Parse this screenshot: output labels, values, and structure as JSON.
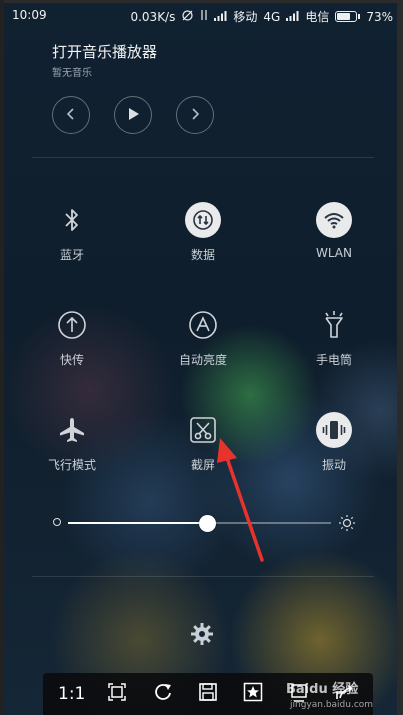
{
  "status_bar": {
    "time": "10:09",
    "speed": "0.03K/s",
    "carrier1": "移动",
    "network": "4G",
    "carrier2": "电信",
    "battery": "73%",
    "battery_level": 0.73
  },
  "music": {
    "title": "打开音乐播放器",
    "subtitle": "暂无音乐",
    "controls": [
      "previous-icon",
      "play-icon",
      "next-icon"
    ]
  },
  "toggles": [
    {
      "id": "bluetooth",
      "label": "蓝牙",
      "icon": "bluetooth-icon",
      "active": false
    },
    {
      "id": "data",
      "label": "数据",
      "icon": "mobile-data-icon",
      "active": true
    },
    {
      "id": "wlan",
      "label": "WLAN",
      "icon": "wifi-icon",
      "active": true
    },
    {
      "id": "quick-share",
      "label": "快传",
      "icon": "upload-icon",
      "active": false
    },
    {
      "id": "auto-brightness",
      "label": "自动亮度",
      "icon": "auto-brightness-icon",
      "active": false
    },
    {
      "id": "flashlight",
      "label": "手电筒",
      "icon": "flashlight-icon",
      "active": false
    },
    {
      "id": "airplane",
      "label": "飞行模式",
      "icon": "airplane-icon",
      "active": false
    },
    {
      "id": "screenshot",
      "label": "截屏",
      "icon": "screenshot-scissors-icon",
      "active": false
    },
    {
      "id": "vibrate",
      "label": "振动",
      "icon": "vibrate-icon",
      "active": true
    }
  ],
  "brightness": {
    "level": 0.53,
    "min_icon": "brightness-low-icon",
    "max_icon": "brightness-high-icon"
  },
  "settings_icon": "gear-icon",
  "annotation": {
    "arrow_color": "#e8322c",
    "target": "screenshot"
  },
  "toolbar": {
    "actual_size_label": "1:1",
    "items": [
      "actual-size",
      "fit-screen-icon",
      "rotate-icon",
      "save-icon",
      "favorite-icon",
      "crop-icon",
      "share-icon"
    ]
  },
  "watermark": {
    "text": "Baidu 经验",
    "url": "jingyan.baidu.com"
  }
}
